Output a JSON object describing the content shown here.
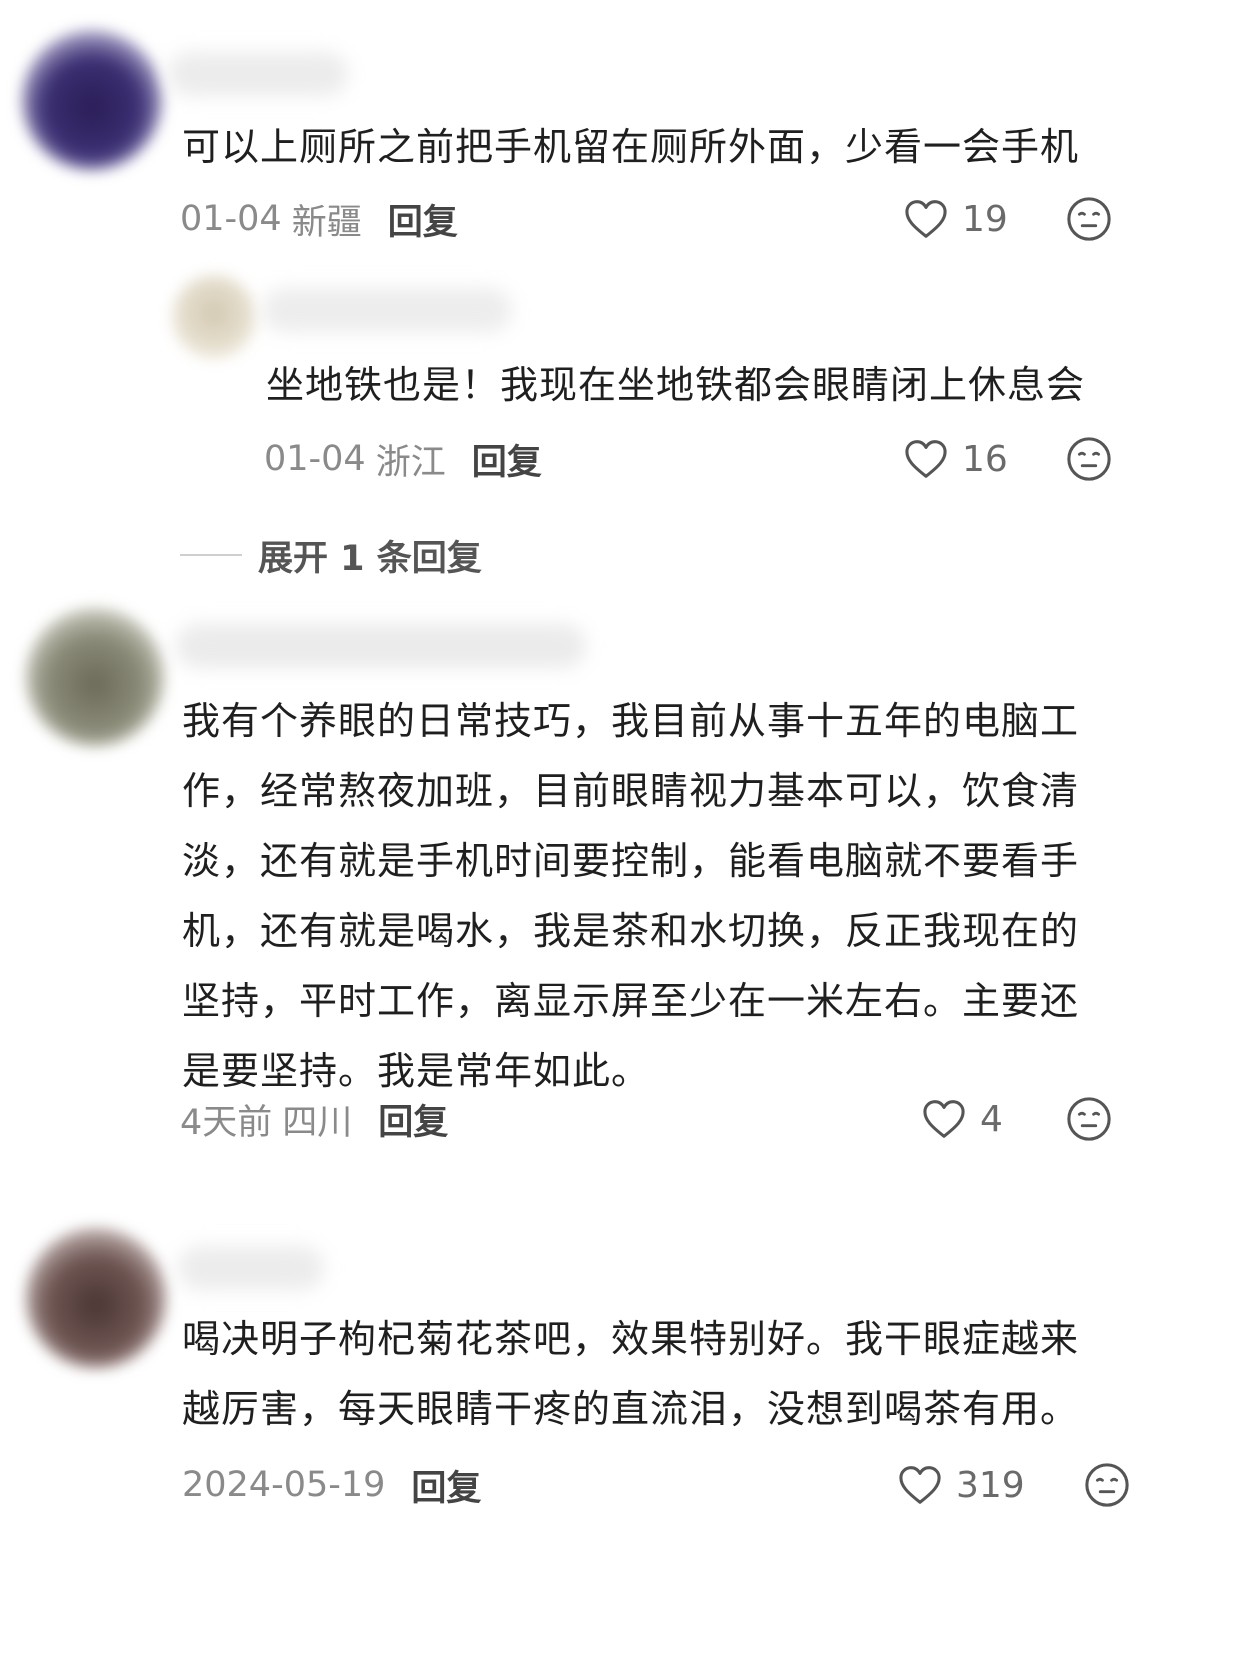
{
  "comments": [
    {
      "text": "可以上厕所之前把手机留在厕所外面，少看一会手机",
      "date": "01-04",
      "location": "新疆",
      "reply_label": "回复",
      "likes": "19",
      "replies": [
        {
          "text": "坐地铁也是！我现在坐地铁都会眼睛闭上休息会",
          "date": "01-04",
          "location": "浙江",
          "reply_label": "回复",
          "likes": "16"
        }
      ],
      "expand_label": "展开 1 条回复"
    },
    {
      "text_lines": [
        "我有个养眼的日常技巧，我目前从事十五年的电脑工",
        "作，经常熬夜加班，目前眼睛视力基本可以，饮食清",
        "淡，还有就是手机时间要控制，能看电脑就不要看手",
        "机，还有就是喝水，我是茶和水切换，反正我现在的",
        "坚持，平时工作，离显示屏至少在一米左右。主要还",
        "是要坚持。我是常年如此。"
      ],
      "date": "4天前",
      "location": "四川",
      "reply_label": "回复",
      "likes": "4"
    },
    {
      "text_lines": [
        "喝决明子枸杞菊花茶吧，效果特别好。我干眼症越来",
        "越厉害，每天眼睛干疼的直流泪，没想到喝茶有用。"
      ],
      "date": "2024-05-19",
      "reply_label": "回复",
      "likes": "319"
    }
  ],
  "icons": {
    "like": "heart-outline-icon",
    "dislike": "neutral-face-icon"
  },
  "colors": {
    "text": "#1f1f1f",
    "meta": "#8a8a8a",
    "icon": "#555555"
  }
}
